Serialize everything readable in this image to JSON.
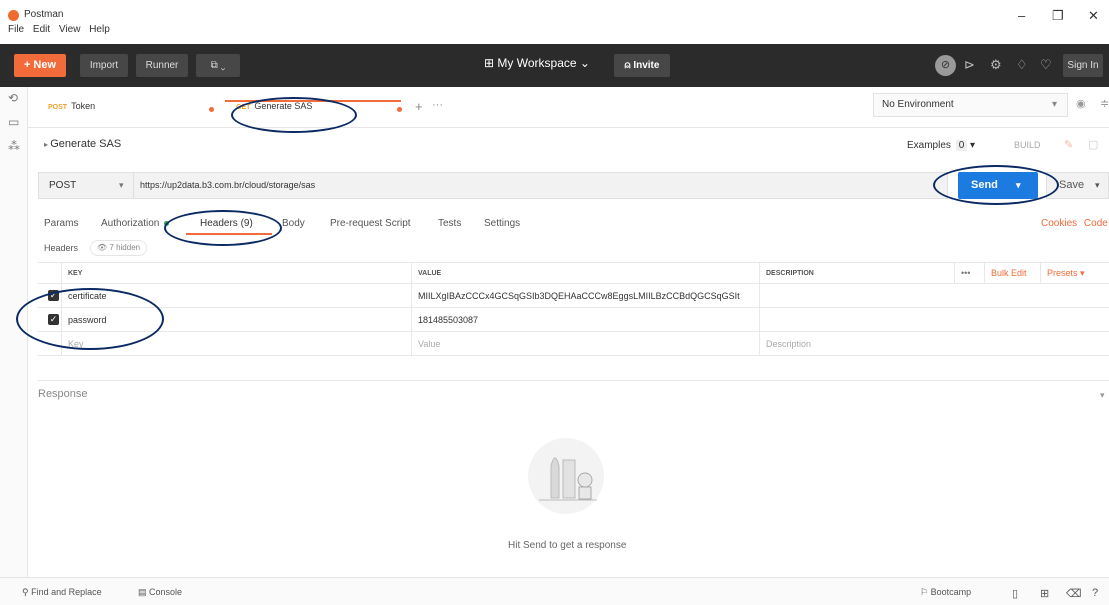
{
  "window": {
    "title": "Postman",
    "menu": [
      "File",
      "Edit",
      "View",
      "Help"
    ]
  },
  "header": {
    "new_label": "+ New",
    "import_label": "Import",
    "runner_label": "Runner",
    "workspace_label": "My Workspace",
    "invite_label": "Invite",
    "signin_label": "Sign In"
  },
  "tabs": [
    {
      "method": "POST",
      "label": "Token"
    },
    {
      "method": "GET",
      "label": "Generate SAS"
    }
  ],
  "environment": "No Environment",
  "request": {
    "breadcrumb": "Generate SAS",
    "examples_label": "Examples",
    "examples_count": "0",
    "build_label": "BUILD",
    "method": "POST",
    "url": "https://up2data.b3.com.br/cloud/storage/sas",
    "send_label": "Send",
    "save_label": "Save"
  },
  "subtabs": {
    "params": "Params",
    "authorization": "Authorization",
    "headers": "Headers (9)",
    "body": "Body",
    "prerequest": "Pre-request Script",
    "tests": "Tests",
    "settings": "Settings",
    "cookies": "Cookies",
    "code": "Code"
  },
  "headers_section": {
    "label": "Headers",
    "hidden": "7 hidden"
  },
  "table": {
    "col_key": "KEY",
    "col_value": "VALUE",
    "col_description": "DESCRIPTION",
    "more": "•••",
    "bulk_edit": "Bulk Edit",
    "presets": "Presets",
    "rows": [
      {
        "key": "certificate",
        "value": "MIILXgIBAzCCCx4GCSqGSIb3DQEHAaCCCw8EggsLMIILBzCCBdQGCSqGSIt",
        "description": ""
      },
      {
        "key": "password",
        "value": "181485503087",
        "description": ""
      }
    ],
    "placeholder_key": "Key",
    "placeholder_value": "Value",
    "placeholder_description": "Description"
  },
  "response": {
    "label": "Response",
    "hint": "Hit Send to get a response"
  },
  "footer": {
    "find_replace": "Find and Replace",
    "console": "Console",
    "bootcamp": "Bootcamp"
  },
  "colors": {
    "accent": "#f26b3a",
    "send": "#1c7be0",
    "annotation": "#0b2a63"
  }
}
